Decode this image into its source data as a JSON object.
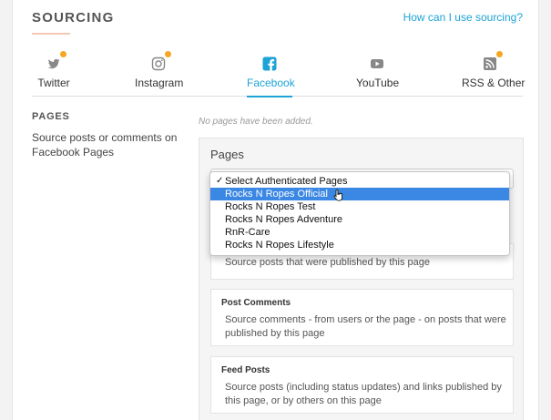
{
  "header": {
    "title": "SOURCING",
    "help_link": "How can I use sourcing?"
  },
  "tabs": [
    {
      "label": "Twitter",
      "icon": "twitter-icon",
      "has_dot": true,
      "active": false
    },
    {
      "label": "Instagram",
      "icon": "instagram-icon",
      "has_dot": true,
      "active": false
    },
    {
      "label": "Facebook",
      "icon": "facebook-icon",
      "has_dot": false,
      "active": true
    },
    {
      "label": "YouTube",
      "icon": "youtube-icon",
      "has_dot": false,
      "active": false
    },
    {
      "label": "RSS & Other",
      "icon": "rss-icon",
      "has_dot": true,
      "active": false
    }
  ],
  "pages_section": {
    "title": "PAGES",
    "description": "Source posts or comments on Facebook Pages",
    "empty_text": "No pages have been added."
  },
  "panel": {
    "title": "Pages",
    "dropdown": {
      "selected": "Select Authenticated Pages",
      "options": [
        "Select Authenticated Pages",
        "Rocks N Ropes Official",
        "Rocks N Ropes Test",
        "Rocks N Ropes Adventure",
        "RnR-Care",
        "Rocks N Ropes Lifestyle"
      ],
      "highlighted_index": 1
    },
    "cards": [
      {
        "title": "",
        "description": "Source posts that were published by this page"
      },
      {
        "title": "Post Comments",
        "description": "Source comments - from users or the page - on posts that were published by this page"
      },
      {
        "title": "Feed Posts",
        "description": "Source posts (including status updates) and links published by this page, or by others on this page"
      }
    ]
  },
  "colors": {
    "accent": "#1ea3d6",
    "dot": "#f5a623",
    "highlight": "#3b87e4",
    "underline": "#f4c8b4"
  }
}
